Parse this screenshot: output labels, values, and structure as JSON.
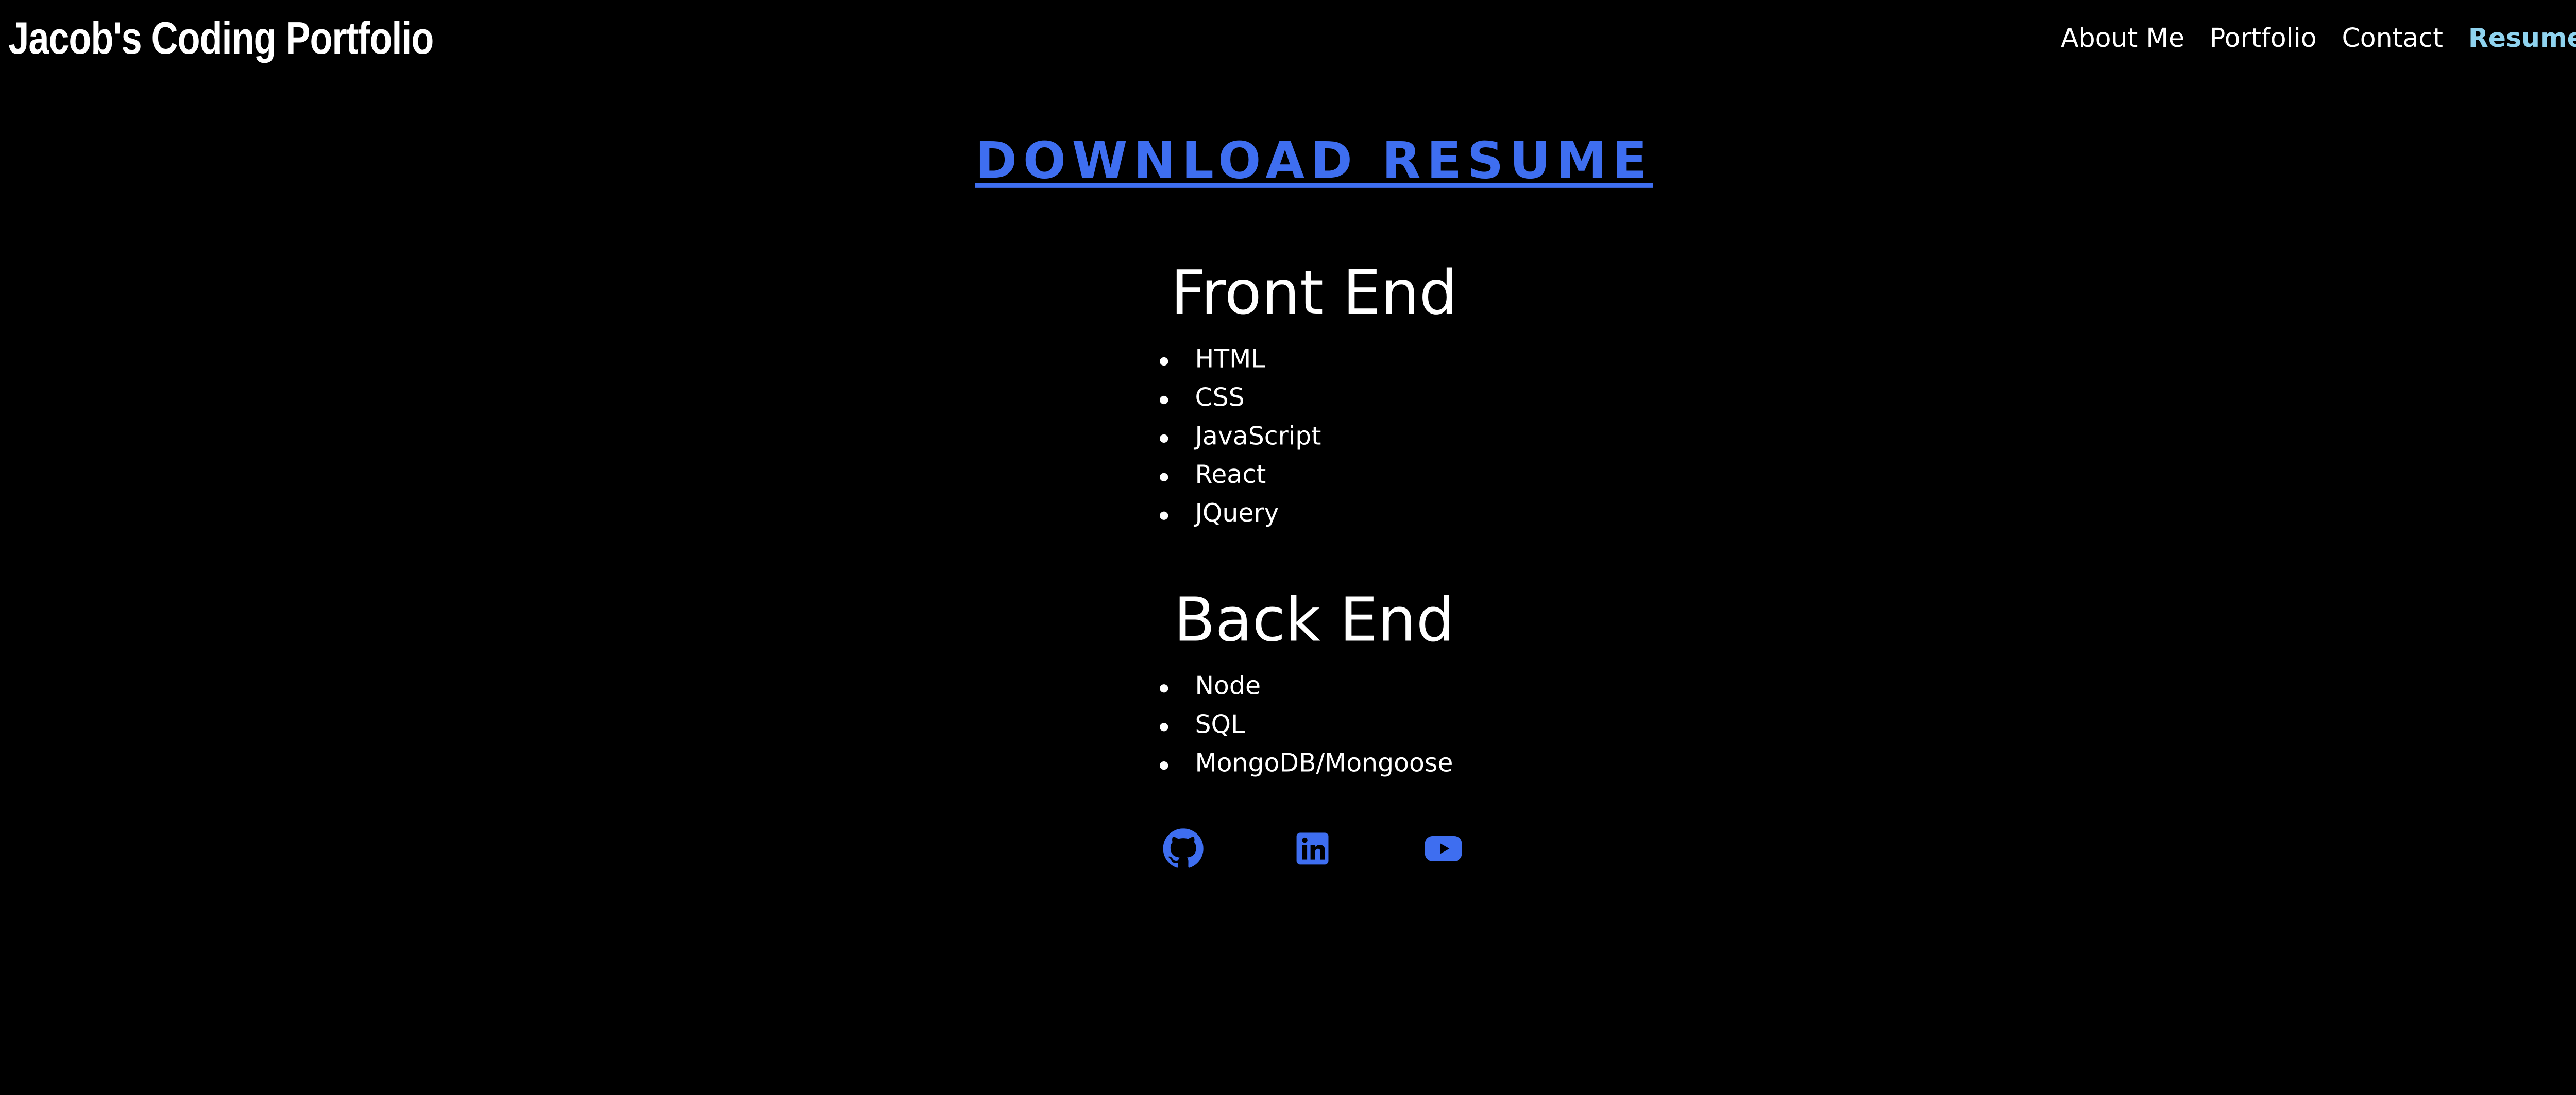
{
  "header": {
    "brand": "Jacob's Coding Portfolio",
    "nav": [
      {
        "label": "About Me",
        "active": false
      },
      {
        "label": "Portfolio",
        "active": false
      },
      {
        "label": "Contact",
        "active": false
      },
      {
        "label": "Resume",
        "active": true
      }
    ]
  },
  "main": {
    "download_label": "DOWNLOAD RESUME",
    "front_end": {
      "title": "Front End",
      "items": [
        "HTML",
        "CSS",
        "JavaScript",
        "React",
        "JQuery"
      ]
    },
    "back_end": {
      "title": "Back End",
      "items": [
        "Node",
        "SQL",
        "MongoDB/Mongoose"
      ]
    }
  },
  "footer": {
    "icons": [
      "github-icon",
      "linkedin-icon",
      "youtube-icon"
    ]
  },
  "colors": {
    "background": "#000000",
    "text": "#ffffff",
    "link": "#3e6ef0",
    "nav_active": "#8fd3ef"
  }
}
